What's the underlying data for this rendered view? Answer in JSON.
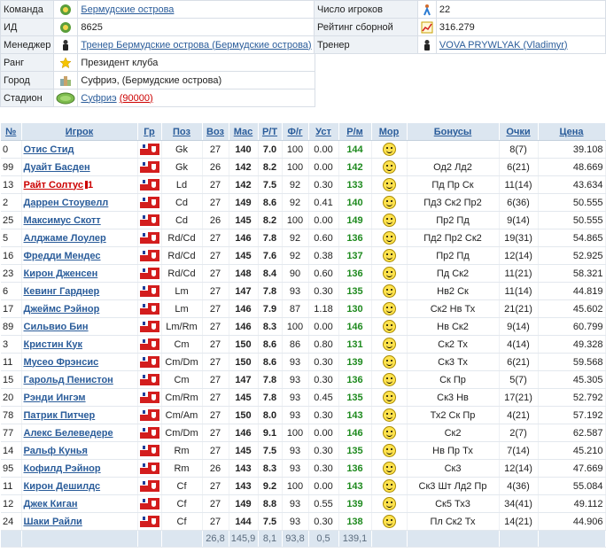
{
  "team_info": {
    "left": [
      {
        "label": "Команда",
        "icon": "team-emblem-icon",
        "value": "Бермудские острова",
        "link": true
      },
      {
        "label": "ИД",
        "icon": "team-emblem-icon",
        "value": "8625",
        "link": false
      },
      {
        "label": "Менеджер",
        "icon": "manager-person-icon",
        "value": "Тренер Бермудские острова (Бермудские острова)",
        "link": true
      },
      {
        "label": "Ранг",
        "icon": "star-icon",
        "value": "Президент клуба",
        "link": false
      },
      {
        "label": "Город",
        "icon": "city-icon",
        "value": "Суфриэ, (Бермудские острова)",
        "link": false
      },
      {
        "label": "Стадион",
        "icon": "stadium-icon",
        "value": "Суфриэ",
        "link": true,
        "extra": "(90000)"
      }
    ],
    "right": [
      {
        "label": "Число игроков",
        "icon": "players-count-icon",
        "value": "22",
        "link": false
      },
      {
        "label": "Рейтинг сборной",
        "icon": "rating-chart-icon",
        "value": "316.279",
        "link": false
      },
      {
        "label": "Тренер",
        "icon": "coach-person-icon",
        "value": "VOVA PRYWLYAK (Vladimyr)",
        "link": true
      }
    ]
  },
  "columns": [
    "№",
    "Игрок",
    "Гр",
    "Поз",
    "Воз",
    "Мас",
    "Р/Т",
    "Ф/г",
    "Уст",
    "Р/м",
    "Мор",
    "Бонусы",
    "Очки",
    "Цена"
  ],
  "players": [
    {
      "num": "0",
      "name": "Отис Стид",
      "pos": "Gk",
      "age": "27",
      "mas": "140",
      "rt": "7.0",
      "fg": "100",
      "ust": "0.00",
      "rm": "144",
      "bonus": "",
      "pts": "8(7)",
      "price": "39.108"
    },
    {
      "num": "99",
      "name": "Дуайт Басден",
      "pos": "Gk",
      "age": "26",
      "mas": "142",
      "rt": "8.2",
      "fg": "100",
      "ust": "0.00",
      "rm": "142",
      "bonus": "Од2 Лд2",
      "pts": "6(21)",
      "price": "48.669"
    },
    {
      "num": "13",
      "name": "Райт Солтус",
      "pos": "Ld",
      "age": "27",
      "mas": "142",
      "rt": "7.5",
      "fg": "92",
      "ust": "0.30",
      "rm": "133",
      "bonus": "Пд Пр Ск",
      "pts": "11(14)",
      "price": "43.634",
      "red": true,
      "card": "1"
    },
    {
      "num": "2",
      "name": "Даррен Стоувелл",
      "pos": "Cd",
      "age": "27",
      "mas": "149",
      "rt": "8.6",
      "fg": "92",
      "ust": "0.41",
      "rm": "140",
      "bonus": "Пд3 Ск2 Пр2",
      "pts": "6(36)",
      "price": "50.555"
    },
    {
      "num": "25",
      "name": "Максимус Скотт",
      "pos": "Cd",
      "age": "26",
      "mas": "145",
      "rt": "8.2",
      "fg": "100",
      "ust": "0.00",
      "rm": "149",
      "bonus": "Пр2 Пд",
      "pts": "9(14)",
      "price": "50.555"
    },
    {
      "num": "5",
      "name": "Алджамe Лоулер",
      "pos": "Rd/Cd",
      "age": "27",
      "mas": "146",
      "rt": "7.8",
      "fg": "92",
      "ust": "0.60",
      "rm": "136",
      "bonus": "Пд2 Пр2 Ск2",
      "pts": "19(31)",
      "price": "54.865"
    },
    {
      "num": "16",
      "name": "Фредди Мендес",
      "pos": "Rd/Cd",
      "age": "27",
      "mas": "145",
      "rt": "7.6",
      "fg": "92",
      "ust": "0.38",
      "rm": "137",
      "bonus": "Пр2 Пд",
      "pts": "12(14)",
      "price": "52.925"
    },
    {
      "num": "23",
      "name": "Кирон Дженсен",
      "pos": "Rd/Cd",
      "age": "27",
      "mas": "148",
      "rt": "8.4",
      "fg": "90",
      "ust": "0.60",
      "rm": "136",
      "bonus": "Пд Ск2",
      "pts": "11(21)",
      "price": "58.321"
    },
    {
      "num": "6",
      "name": "Кевинг Гарднер",
      "pos": "Lm",
      "age": "27",
      "mas": "147",
      "rt": "7.8",
      "fg": "93",
      "ust": "0.30",
      "rm": "135",
      "bonus": "Нв2 Ск",
      "pts": "11(14)",
      "price": "44.819"
    },
    {
      "num": "17",
      "name": "Джеймс Рэйнор",
      "pos": "Lm",
      "age": "27",
      "mas": "146",
      "rt": "7.9",
      "fg": "87",
      "ust": "1.18",
      "rm": "130",
      "bonus": "Ск2 Нв Тх",
      "pts": "21(21)",
      "price": "45.602"
    },
    {
      "num": "89",
      "name": "Сильвио Бин",
      "pos": "Lm/Rm",
      "age": "27",
      "mas": "146",
      "rt": "8.3",
      "fg": "100",
      "ust": "0.00",
      "rm": "146",
      "bonus": "Нв Ск2",
      "pts": "9(14)",
      "price": "60.799"
    },
    {
      "num": "3",
      "name": "Кристин Кук",
      "pos": "Cm",
      "age": "27",
      "mas": "150",
      "rt": "8.6",
      "fg": "86",
      "ust": "0.80",
      "rm": "131",
      "bonus": "Ск2 Тх",
      "pts": "4(14)",
      "price": "49.328"
    },
    {
      "num": "11",
      "name": "Мусео Фрэнсис",
      "pos": "Cm/Dm",
      "age": "27",
      "mas": "150",
      "rt": "8.6",
      "fg": "93",
      "ust": "0.30",
      "rm": "139",
      "bonus": "Ск3 Тх",
      "pts": "6(21)",
      "price": "59.568"
    },
    {
      "num": "15",
      "name": "Гарольд Пенистон",
      "pos": "Cm",
      "age": "27",
      "mas": "147",
      "rt": "7.8",
      "fg": "93",
      "ust": "0.30",
      "rm": "136",
      "bonus": "Ск Пр",
      "pts": "5(7)",
      "price": "45.305"
    },
    {
      "num": "20",
      "name": "Рэнди Ингэм",
      "pos": "Cm/Rm",
      "age": "27",
      "mas": "145",
      "rt": "7.8",
      "fg": "93",
      "ust": "0.45",
      "rm": "135",
      "bonus": "Ск3 Нв",
      "pts": "17(21)",
      "price": "52.792"
    },
    {
      "num": "78",
      "name": "Патрик Питчер",
      "pos": "Cm/Am",
      "pos2": "",
      "age": "27",
      "mas": "150",
      "rt": "8.0",
      "fg": "93",
      "ust": "0.30",
      "rm": "143",
      "bonus": "Тх2 Ск Пр",
      "pts": "4(21)",
      "price": "57.192"
    },
    {
      "num": "77",
      "name": "Алекс Белеведере",
      "pos": "Cm/Dm",
      "age": "27",
      "mas": "146",
      "rt": "9.1",
      "fg": "100",
      "ust": "0.00",
      "rm": "146",
      "bonus": "Ск2",
      "pts": "2(7)",
      "price": "62.587"
    },
    {
      "num": "14",
      "name": "Ральф Кунья",
      "pos": "Rm",
      "age": "27",
      "mas": "145",
      "rt": "7.5",
      "fg": "93",
      "ust": "0.30",
      "rm": "135",
      "bonus": "Нв Пр Тх",
      "pts": "7(14)",
      "price": "45.210"
    },
    {
      "num": "95",
      "name": "Кофилд Рэйнор",
      "pos": "Rm",
      "age": "26",
      "mas": "143",
      "rt": "8.3",
      "fg": "93",
      "ust": "0.30",
      "rm": "136",
      "bonus": "Ск3",
      "pts": "12(14)",
      "price": "47.669"
    },
    {
      "num": "11",
      "name": "Кирон Дешилдс",
      "pos": "Cf",
      "age": "27",
      "mas": "143",
      "rt": "9.2",
      "fg": "100",
      "ust": "0.00",
      "rm": "143",
      "bonus": "Ск3 Шт Лд2 Пр",
      "pts": "4(36)",
      "price": "55.084"
    },
    {
      "num": "12",
      "name": "Джек Киган",
      "pos": "Cf",
      "age": "27",
      "mas": "149",
      "rt": "8.8",
      "fg": "93",
      "ust": "0.55",
      "rm": "139",
      "bonus": "Ск5 Тх3",
      "pts": "34(41)",
      "price": "49.112"
    },
    {
      "num": "24",
      "name": "Шаки Райли",
      "pos": "Cf",
      "age": "27",
      "mas": "144",
      "rt": "7.5",
      "fg": "93",
      "ust": "0.30",
      "rm": "138",
      "bonus": "Пл Ск2 Тх",
      "pts": "14(21)",
      "price": "44.906"
    }
  ],
  "totals": {
    "age": "26,8",
    "mas": "145,9",
    "rt": "8,1",
    "fg": "93,8",
    "ust": "0,5",
    "rm": "139,1"
  },
  "colors": {
    "header_bg": "#dce6f0",
    "link": "#2a5c9a",
    "rm_green": "#1e8a1e",
    "red_player": "#cc0000"
  }
}
